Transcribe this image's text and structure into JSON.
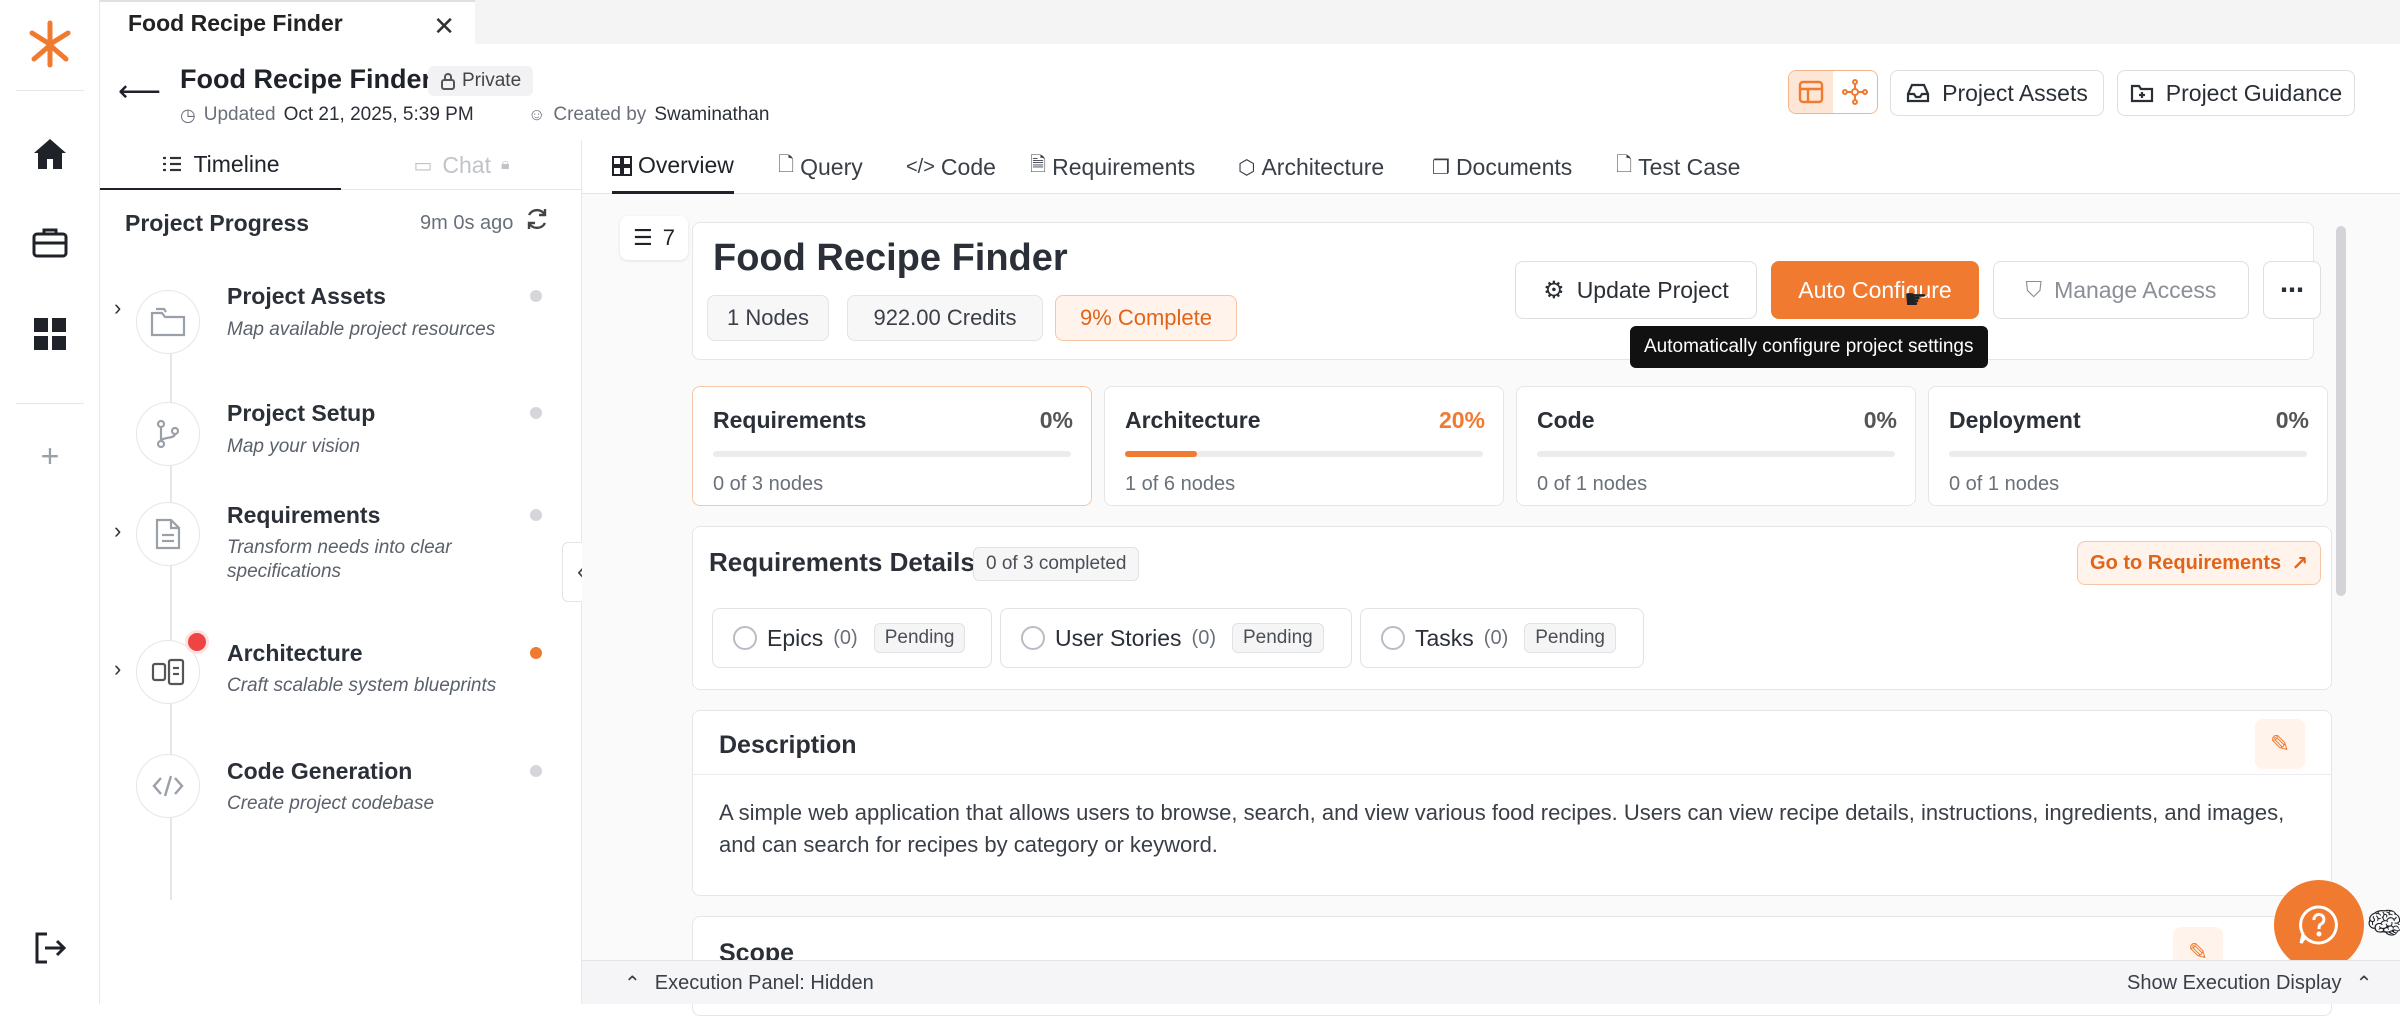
{
  "window_tab": {
    "title": "Food Recipe Finder"
  },
  "header": {
    "title": "Food Recipe Finder",
    "visibility": "Private",
    "updated_label": "Updated",
    "updated_value": "Oct 21, 2025, 5:39 PM",
    "created_label": "Created by",
    "created_value": "Swaminathan",
    "assets_button": "Project Assets",
    "guidance_button": "Project Guidance"
  },
  "left_tabs": {
    "timeline": "Timeline",
    "chat": "Chat"
  },
  "progress": {
    "title": "Project Progress",
    "elapsed": "9m 0s ago"
  },
  "steps": [
    {
      "title": "Project Assets",
      "subtitle": "Map available project resources"
    },
    {
      "title": "Project Setup",
      "subtitle": "Map your vision"
    },
    {
      "title": "Requirements",
      "subtitle": "Transform needs into clear specifications"
    },
    {
      "title": "Architecture",
      "subtitle": "Craft scalable system blueprints"
    },
    {
      "title": "Code Generation",
      "subtitle": "Create project codebase"
    }
  ],
  "main_tabs": [
    "Overview",
    "Query",
    "Code",
    "Requirements",
    "Architecture",
    "Documents",
    "Test Case"
  ],
  "toc_count": "7",
  "project": {
    "title": "Food Recipe Finder",
    "nodes": "1 Nodes",
    "credits": "922.00 Credits",
    "complete": "9% Complete",
    "update_button": "Update Project",
    "auto_button": "Auto Configure",
    "manage_button": "Manage Access",
    "tooltip": "Automatically configure project settings"
  },
  "progress_cards": [
    {
      "name": "Requirements",
      "percent": "0%",
      "count": "0 of 3 nodes",
      "fill": 0
    },
    {
      "name": "Architecture",
      "percent": "20%",
      "count": "1 of 6 nodes",
      "fill": 0.2
    },
    {
      "name": "Code",
      "percent": "0%",
      "count": "0 of 1 nodes",
      "fill": 0
    },
    {
      "name": "Deployment",
      "percent": "0%",
      "count": "0 of 1 nodes",
      "fill": 0
    }
  ],
  "req_details": {
    "title": "Requirements Details",
    "completed": "0 of 3 completed",
    "goto": "Go to Requirements",
    "chips": [
      {
        "label": "Epics",
        "count": "(0)",
        "status": "Pending"
      },
      {
        "label": "User Stories",
        "count": "(0)",
        "status": "Pending"
      },
      {
        "label": "Tasks",
        "count": "(0)",
        "status": "Pending"
      }
    ]
  },
  "description": {
    "title": "Description",
    "text": "A simple web application that allows users to browse, search, and view various food recipes. Users can view recipe details, instructions, ingredients, and images, and can search for recipes by category or keyword."
  },
  "scope": {
    "title": "Scope"
  },
  "bottom_bar": {
    "left": "Execution Panel: Hidden",
    "right": "Show Execution Display"
  },
  "colors": {
    "accent": "#f07a2f",
    "accent_light": "#fff3eb",
    "alert": "#ef4444"
  }
}
